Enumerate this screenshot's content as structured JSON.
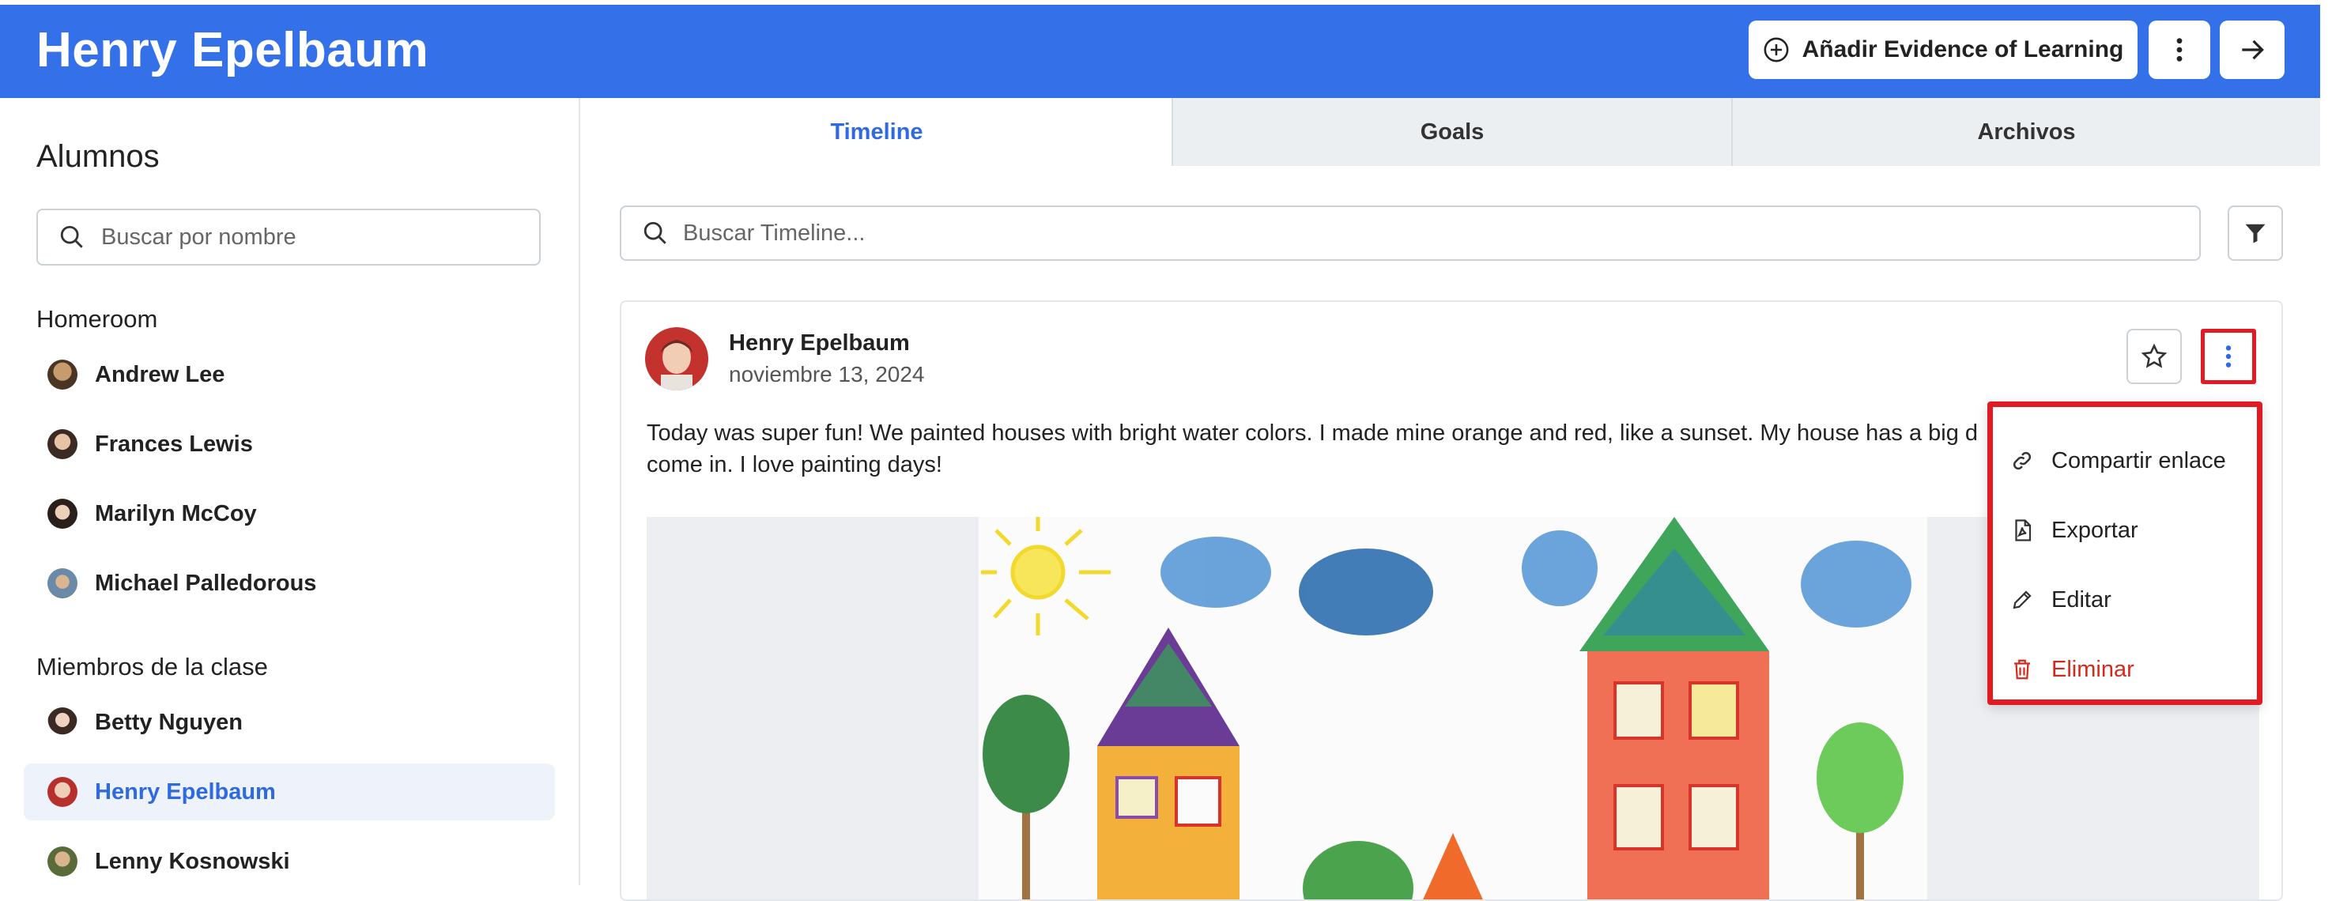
{
  "header": {
    "title": "Henry Epelbaum",
    "add_button_label": "Añadir Evidence of Learning"
  },
  "sidebar": {
    "heading": "Alumnos",
    "search_placeholder": "Buscar por nombre",
    "groups": [
      {
        "label": "Homeroom",
        "students": [
          "Andrew Lee",
          "Frances Lewis",
          "Marilyn McCoy",
          "Michael Palledorous"
        ]
      },
      {
        "label": "Miembros de la clase",
        "students": [
          "Betty Nguyen",
          "Henry Epelbaum",
          "Lenny Kosnowski"
        ]
      }
    ],
    "active_student": "Henry Epelbaum"
  },
  "tabs": [
    "Timeline",
    "Goals",
    "Archivos"
  ],
  "active_tab": "Timeline",
  "timeline": {
    "search_placeholder": "Buscar Timeline...",
    "post": {
      "author": "Henry Epelbaum",
      "date": "noviembre 13, 2024",
      "text": "Today was super fun! We painted houses with bright water colors. I made mine orange and red, like a sunset. My house has a big d",
      "text_line2": "come in. I love painting days!"
    }
  },
  "menu": {
    "items": [
      {
        "label": "Compartir enlace",
        "icon": "link-icon"
      },
      {
        "label": "Exportar",
        "icon": "pdf-icon"
      },
      {
        "label": "Editar",
        "icon": "pencil-icon"
      },
      {
        "label": "Eliminar",
        "icon": "trash-icon"
      }
    ]
  },
  "colors": {
    "header_bg": "#3471e9",
    "accent": "#2f6ae0",
    "highlight_border": "#e01b24",
    "danger": "#d42a1c"
  }
}
